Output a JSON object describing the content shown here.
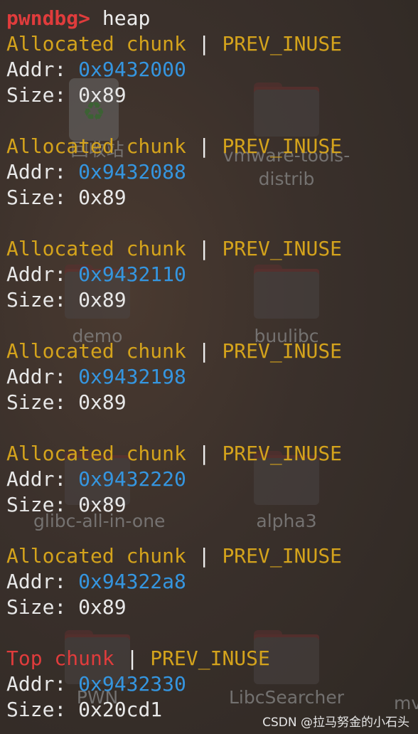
{
  "terminal": {
    "prompt": "pwndbg>",
    "command": " heap",
    "sep": " | ",
    "addr_label": "Addr: ",
    "size_label": "Size: ",
    "chunks": [
      {
        "kind": "Allocated chunk",
        "flag": "PREV_INUSE",
        "addr": "0x9432000",
        "size": "0x89"
      },
      {
        "kind": "Allocated chunk",
        "flag": "PREV_INUSE",
        "addr": "0x9432088",
        "size": "0x89"
      },
      {
        "kind": "Allocated chunk",
        "flag": "PREV_INUSE",
        "addr": "0x9432110",
        "size": "0x89"
      },
      {
        "kind": "Allocated chunk",
        "flag": "PREV_INUSE",
        "addr": "0x9432198",
        "size": "0x89"
      },
      {
        "kind": "Allocated chunk",
        "flag": "PREV_INUSE",
        "addr": "0x9432220",
        "size": "0x89"
      },
      {
        "kind": "Allocated chunk",
        "flag": "PREV_INUSE",
        "addr": "0x94322a8",
        "size": "0x89"
      }
    ],
    "top_chunk": {
      "kind": "Top chunk",
      "flag": "PREV_INUSE",
      "addr": "0x9432330",
      "size": "0x20cd1"
    }
  },
  "desktop_icons": [
    {
      "label": "回收站",
      "icon": "trash-icon"
    },
    {
      "label": "vmware-tools-\ndistrib",
      "icon": "folder-icon"
    },
    {
      "label": "demo",
      "icon": "folder-icon"
    },
    {
      "label": "buulibc",
      "icon": "folder-icon"
    },
    {
      "label": "glibc-all-in-one",
      "icon": "folder-icon"
    },
    {
      "label": "alpha3",
      "icon": "folder-icon"
    },
    {
      "label": "PWN",
      "icon": "folder-icon"
    },
    {
      "label": "LibcSearcher",
      "icon": "folder-icon"
    },
    {
      "label": "mv",
      "icon": "folder-icon"
    }
  ],
  "watermark": "CSDN @拉马努金的小石头",
  "colors": {
    "prompt": "#e03c3c",
    "allocated": "#d4a31c",
    "top": "#e03c3c",
    "address": "#3596e0",
    "text": "#eeeeee"
  }
}
